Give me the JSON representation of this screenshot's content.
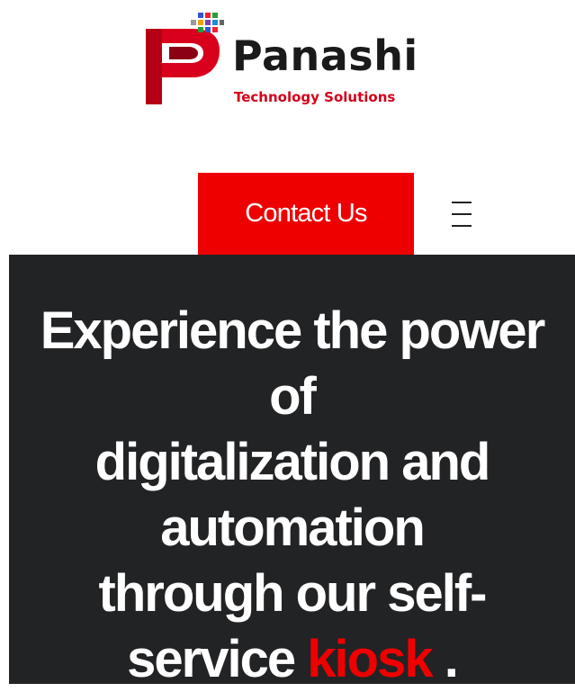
{
  "brand": {
    "name": "Panashi",
    "tagline": "Technology Solutions"
  },
  "header": {
    "contact_label": "Contact Us",
    "menu_icon": "hamburger-menu-icon"
  },
  "hero": {
    "line1": "Experience the power",
    "line2": "of",
    "line3": "digitalization and",
    "line4": "automation",
    "line5": "through our self-",
    "line6_prefix": "service ",
    "line6_highlight": "kiosk",
    "line6_suffix": " ."
  },
  "colors": {
    "accent": "#ee0000",
    "hero_bg": "#222325",
    "text_dark": "#1a1a1a"
  }
}
